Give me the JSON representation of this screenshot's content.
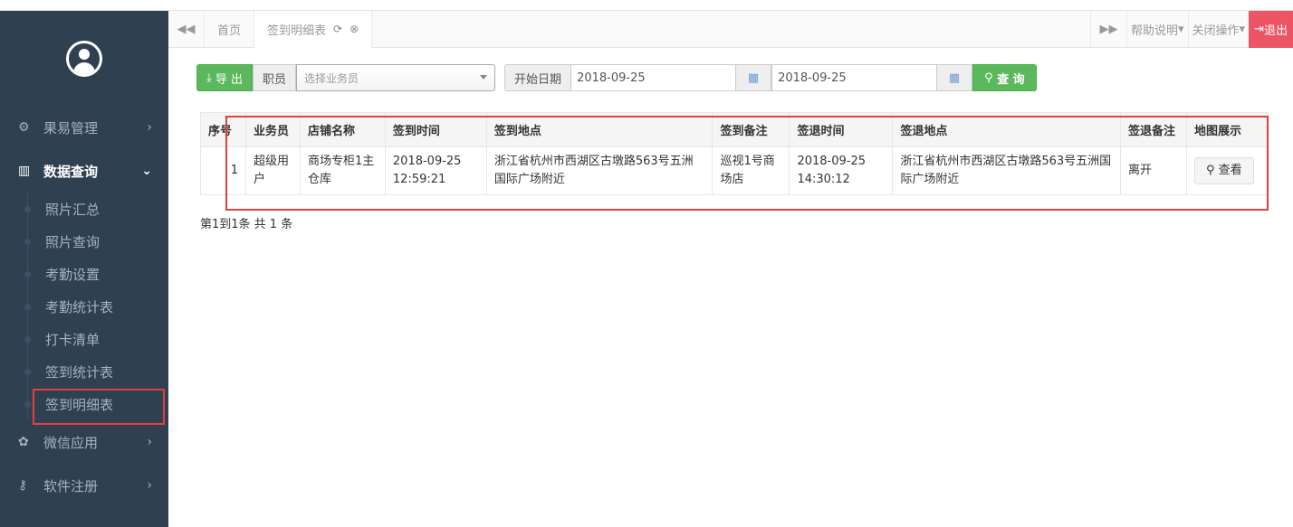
{
  "sidebar": {
    "menu": [
      {
        "label": "果易管理",
        "icon": "gears-icon",
        "glyph": "⚙"
      },
      {
        "label": "数据查询",
        "icon": "bar-chart-icon",
        "glyph": "▥"
      }
    ],
    "submenu": [
      {
        "label": "照片汇总"
      },
      {
        "label": "照片查询"
      },
      {
        "label": "考勤设置"
      },
      {
        "label": "考勤统计表"
      },
      {
        "label": "打卡清单"
      },
      {
        "label": "签到统计表"
      },
      {
        "label": "签到明细表"
      }
    ],
    "bottom_menu": [
      {
        "label": "微信应用",
        "icon": "wechat-icon",
        "glyph": "✿"
      },
      {
        "label": "软件注册",
        "icon": "key-icon",
        "glyph": "⚷"
      }
    ]
  },
  "tabs": {
    "home": "首页",
    "active": "签到明细表",
    "help": "帮助说明",
    "close_ops": "关闭操作",
    "logout": "退出"
  },
  "toolbar": {
    "export_label": "导 出",
    "staff_label": "职员",
    "staff_placeholder": "选择业务员",
    "start_date_label": "开始日期",
    "start_date": "2018-09-25",
    "end_date": "2018-09-25",
    "search_label": "查 询"
  },
  "table": {
    "headers": [
      "序号",
      "业务员",
      "店铺名称",
      "签到时间",
      "签到地点",
      "签到备注",
      "签退时间",
      "签退地点",
      "签退备注",
      "地图展示"
    ],
    "rows": [
      {
        "index": "1",
        "salesman": "超级用户",
        "store": "商场专柜1主仓库",
        "checkin_time": "2018-09-25 12:59:21",
        "checkin_place": "浙江省杭州市西湖区古墩路563号五洲国际广场附近",
        "checkin_note": "巡视1号商场店",
        "checkout_time": "2018-09-25 14:30:12",
        "checkout_place": "浙江省杭州市西湖区古墩路563号五洲国际广场附近",
        "checkout_note": "离开",
        "map_btn": "查看"
      }
    ]
  },
  "pager": "第1到1条 共 1 条",
  "colors": {
    "sidebar": "#2f4050",
    "green": "#5cb85c",
    "red": "#e53e3e",
    "logout": "#ed5565"
  }
}
